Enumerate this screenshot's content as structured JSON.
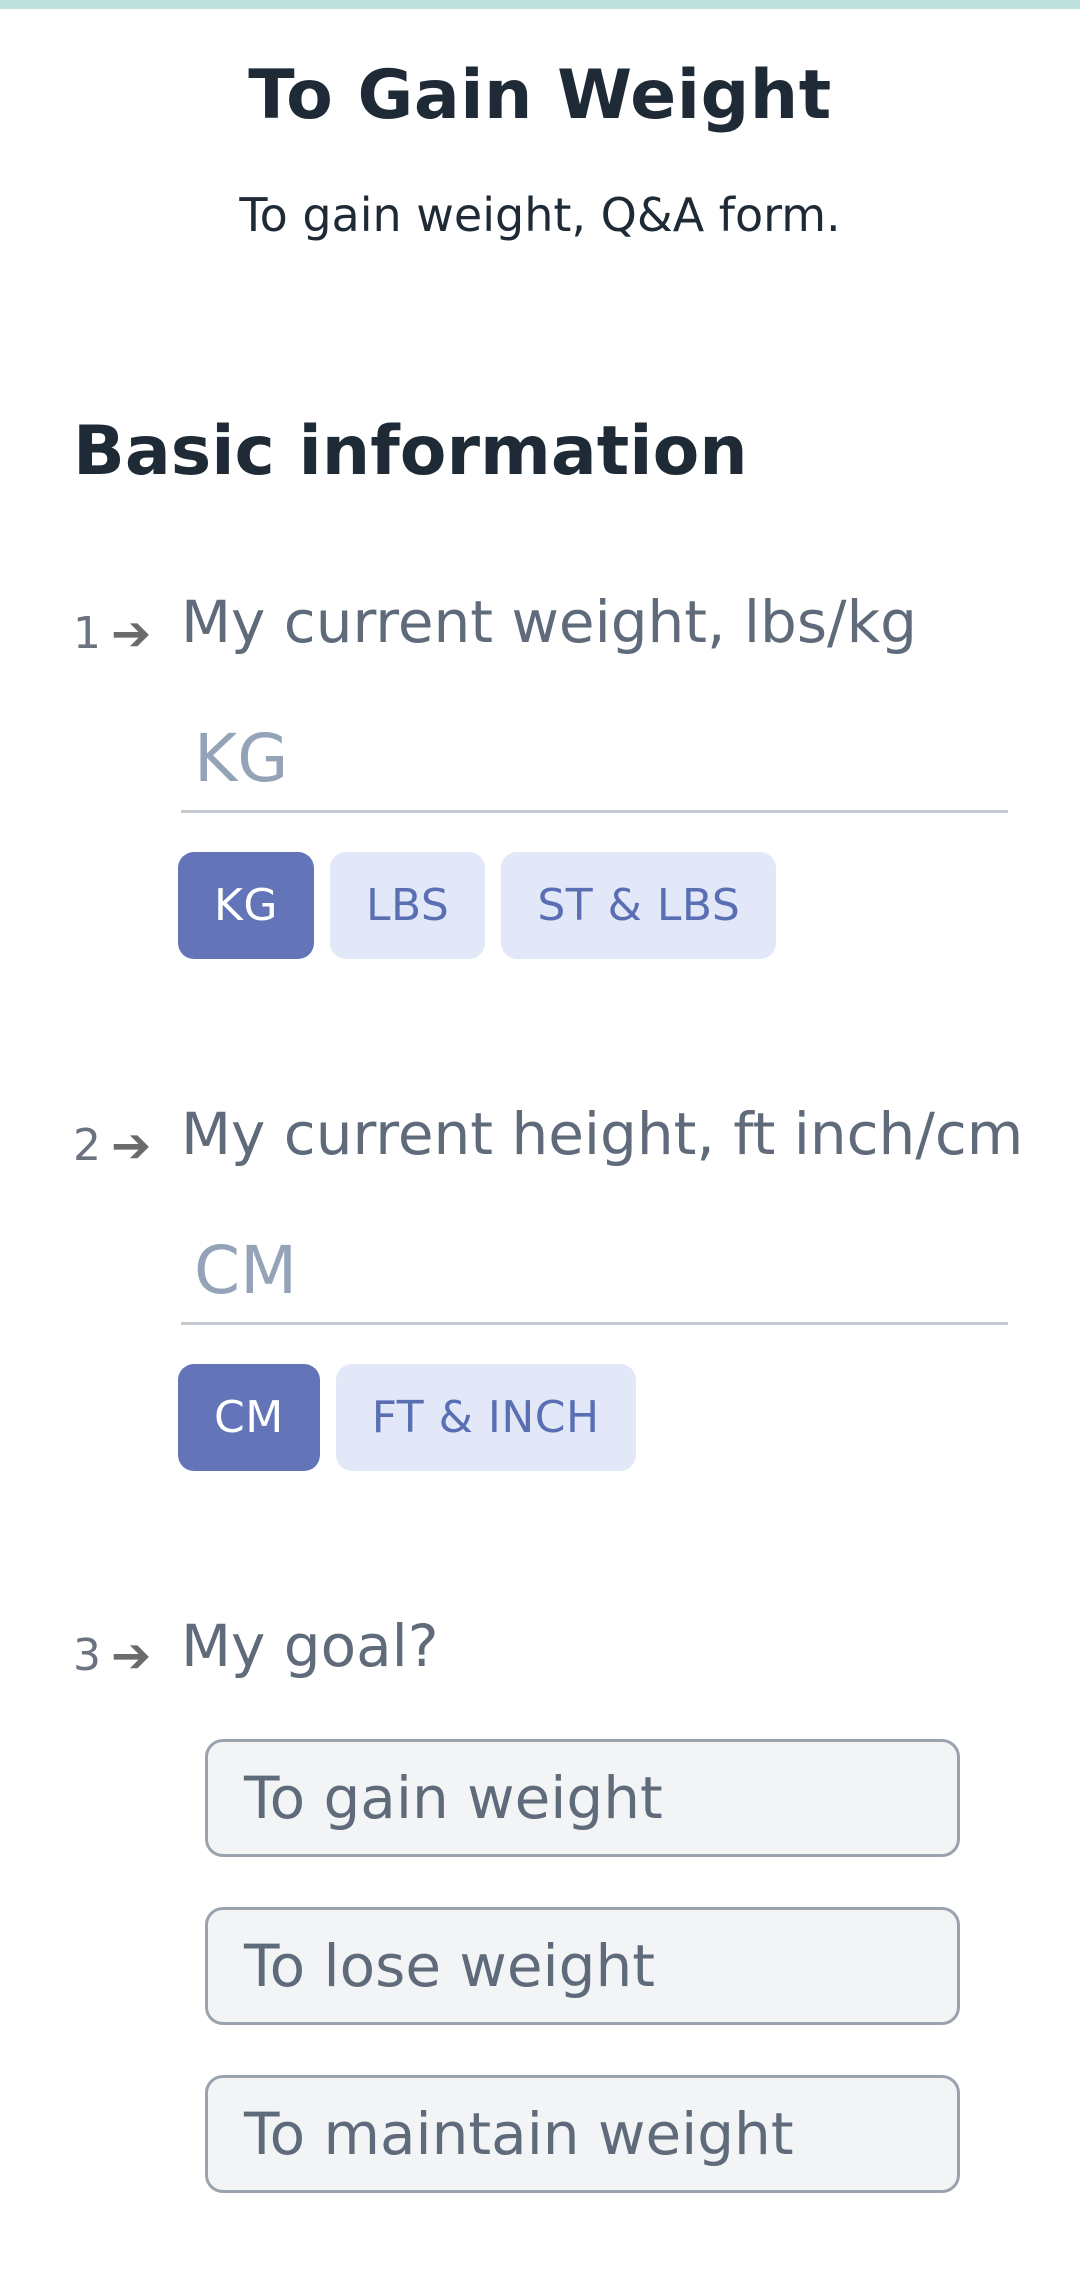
{
  "header": {
    "title": "To Gain Weight",
    "subtitle": "To gain weight, Q&A form."
  },
  "section": {
    "title": "Basic information"
  },
  "questions": [
    {
      "number": "1",
      "text": "My current weight, lbs/kg",
      "input_placeholder": "KG",
      "input_value": "",
      "units": [
        "KG",
        "LBS",
        "ST & LBS"
      ],
      "selected_unit": "KG"
    },
    {
      "number": "2",
      "text": "My current height, ft inch/cm",
      "input_placeholder": "CM",
      "input_value": "",
      "units": [
        "CM",
        "FT & INCH"
      ],
      "selected_unit": "CM"
    },
    {
      "number": "3",
      "text": "My goal?",
      "options": [
        "To gain weight",
        "To lose weight",
        "To maintain weight"
      ]
    }
  ],
  "icons": {
    "arrow": "arrow-right-icon"
  },
  "colors": {
    "top_bar": "#bfe3dc",
    "chip_active_bg": "#6375b8",
    "chip_inactive_bg": "#e2e8f8",
    "chip_inactive_text": "#5a6fb3"
  }
}
